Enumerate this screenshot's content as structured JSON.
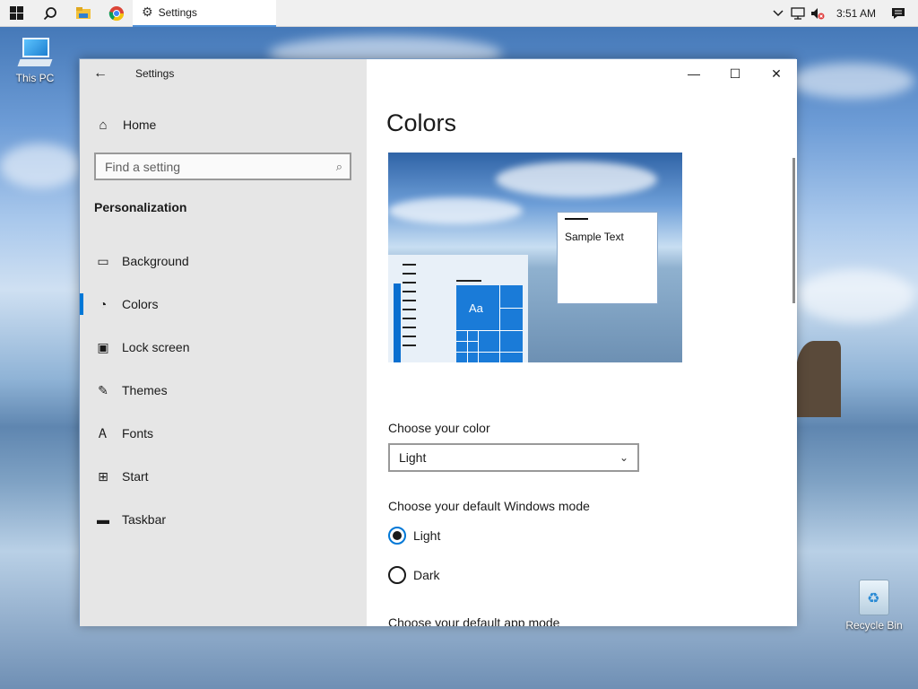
{
  "taskbar": {
    "task_label": "Settings",
    "clock": "3:51 AM"
  },
  "desktop": {
    "this_pc": "This PC",
    "recycle_bin": "Recycle Bin"
  },
  "window": {
    "app_title": "Settings",
    "home_label": "Home",
    "search_placeholder": "Find a setting",
    "section_title": "Personalization",
    "nav": [
      {
        "label": "Background",
        "icon": "picture-icon"
      },
      {
        "label": "Colors",
        "icon": "palette-icon"
      },
      {
        "label": "Lock screen",
        "icon": "lock-screen-icon"
      },
      {
        "label": "Themes",
        "icon": "themes-icon"
      },
      {
        "label": "Fonts",
        "icon": "fonts-icon"
      },
      {
        "label": "Start",
        "icon": "start-icon"
      },
      {
        "label": "Taskbar",
        "icon": "taskbar-icon"
      }
    ],
    "active_nav": "Colors",
    "accent_color": "#0078d7"
  },
  "main": {
    "page_title": "Colors",
    "preview": {
      "sample_text": "Sample Text",
      "tile_text": "Aa"
    },
    "choose_color_label": "Choose your color",
    "choose_color_value": "Light",
    "windows_mode_label": "Choose your default Windows mode",
    "windows_mode_options": [
      "Light",
      "Dark"
    ],
    "windows_mode_selected": "Light",
    "app_mode_label": "Choose your default app mode"
  }
}
